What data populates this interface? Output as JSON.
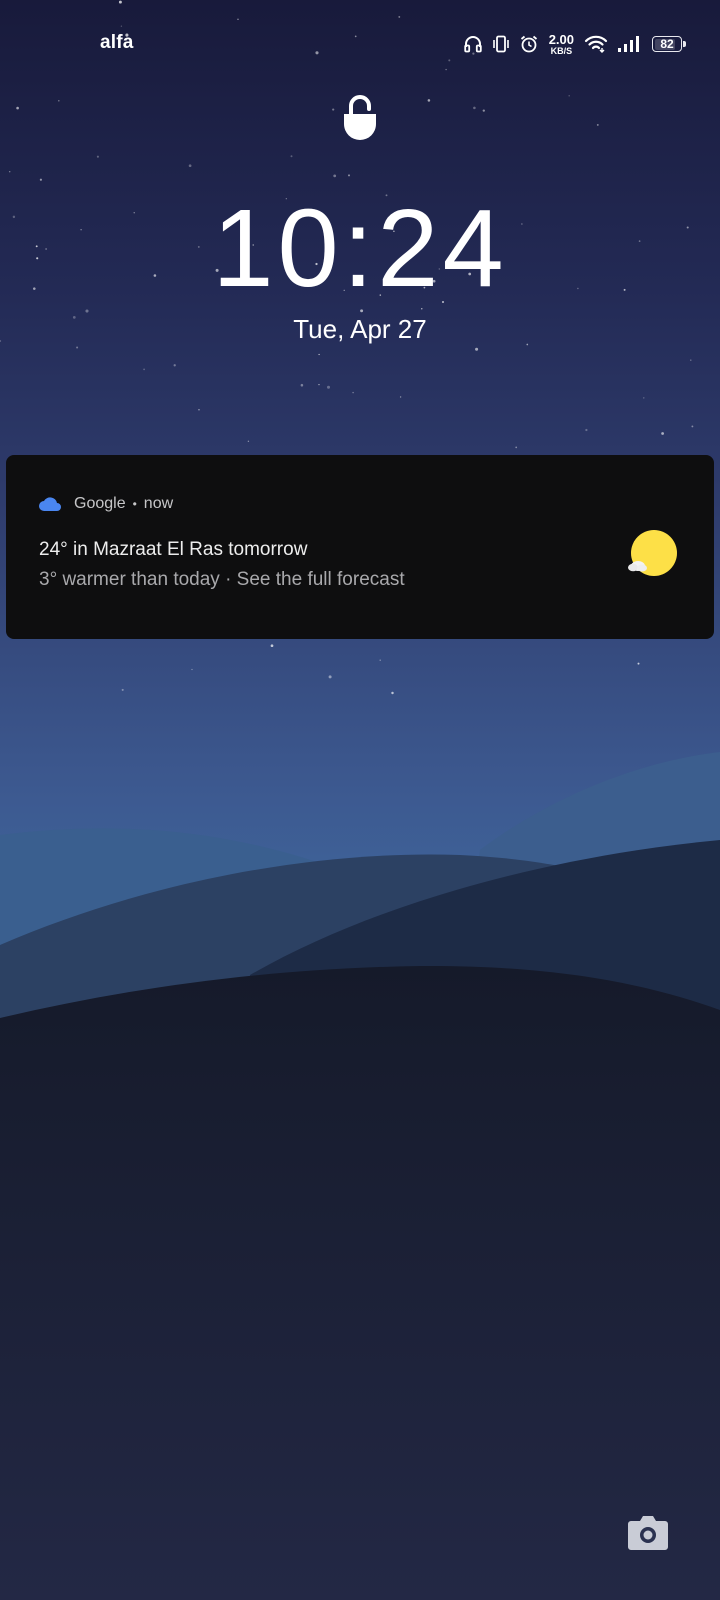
{
  "status_bar": {
    "carrier": "alfa",
    "net_speed_value": "2.00",
    "net_speed_unit": "KB/S",
    "battery_level": "82",
    "battery_fraction": 0.82,
    "icons": [
      "headphones-icon",
      "vibrate-icon",
      "alarm-icon",
      "wifi-icon",
      "signal-icon",
      "battery-icon"
    ]
  },
  "lockscreen": {
    "lock_icon": "lock-icon",
    "time": "10:24",
    "date": "Tue, Apr 27"
  },
  "notification": {
    "app_icon": "cloud-icon",
    "app_name": "Google",
    "separator": "•",
    "time": "now",
    "title": "24° in Mazraat El Ras tomorrow",
    "body": "3° warmer than today · See the full forecast",
    "weather_icon": "sun-cloud-icon"
  },
  "shortcuts": {
    "camera_icon": "camera-icon"
  },
  "colors": {
    "notification_bg": "#0e0e0f",
    "google_blue": "#4a86f0",
    "sun_yellow": "#fde047"
  }
}
